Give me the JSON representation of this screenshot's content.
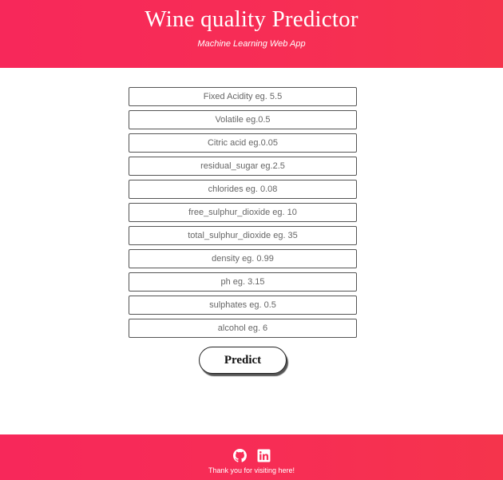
{
  "header": {
    "title": "Wine quality Predictor",
    "subtitle": "Machine Learning Web App",
    "background_color": "#f7285a"
  },
  "form": {
    "fields": [
      {
        "name": "fixed_acidity",
        "placeholder": "Fixed Acidity eg. 5.5",
        "value": ""
      },
      {
        "name": "volatile",
        "placeholder": "Volatile eg.0.5",
        "value": ""
      },
      {
        "name": "citric_acid",
        "placeholder": "Citric acid eg.0.05",
        "value": ""
      },
      {
        "name": "residual_sugar",
        "placeholder": "residual_sugar eg.2.5",
        "value": ""
      },
      {
        "name": "chlorides",
        "placeholder": "chlorides eg. 0.08",
        "value": ""
      },
      {
        "name": "free_sulphur_dioxide",
        "placeholder": "free_sulphur_dioxide eg. 10",
        "value": ""
      },
      {
        "name": "total_sulphur_dioxide",
        "placeholder": "total_sulphur_dioxide eg. 35",
        "value": ""
      },
      {
        "name": "density",
        "placeholder": "density eg. 0.99",
        "value": ""
      },
      {
        "name": "ph",
        "placeholder": "ph eg. 3.15",
        "value": ""
      },
      {
        "name": "sulphates",
        "placeholder": "sulphates eg. 0.5",
        "value": ""
      },
      {
        "name": "alcohol",
        "placeholder": "alcohol eg. 6",
        "value": ""
      }
    ],
    "submit_label": "Predict"
  },
  "footer": {
    "icons": [
      "github-icon",
      "linkedin-icon"
    ],
    "thanks_text": "Thank you for visiting here!",
    "background_color": "#f7285a"
  }
}
